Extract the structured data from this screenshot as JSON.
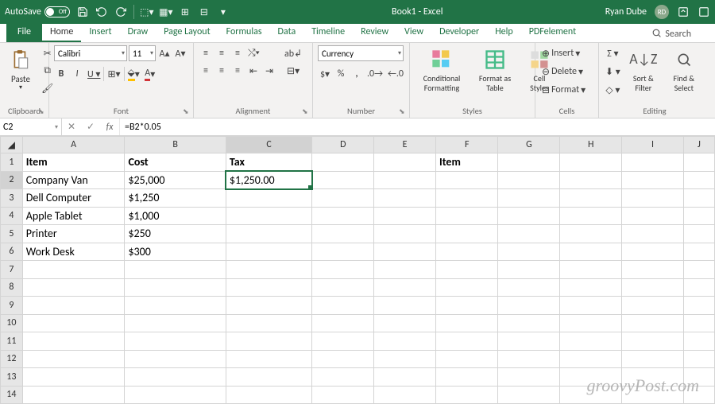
{
  "titlebar": {
    "autosave": "AutoSave",
    "toggle": "Off",
    "title": "Book1 - Excel",
    "user": "Ryan Dube",
    "initials": "RD"
  },
  "tabs": [
    "File",
    "Home",
    "Insert",
    "Draw",
    "Page Layout",
    "Formulas",
    "Data",
    "Timeline",
    "Review",
    "View",
    "Developer",
    "Help",
    "PDFelement"
  ],
  "search": "Search",
  "ribbon": {
    "clipboard": {
      "label": "Clipboard",
      "paste": "Paste"
    },
    "font": {
      "label": "Font",
      "name": "Calibri",
      "size": "11"
    },
    "alignment": {
      "label": "Alignment"
    },
    "number": {
      "label": "Number",
      "format": "Currency"
    },
    "styles": {
      "label": "Styles",
      "cond": "Conditional Formatting",
      "table": "Format as Table",
      "cell": "Cell Styles"
    },
    "cells": {
      "label": "Cells",
      "insert": "Insert",
      "delete": "Delete",
      "format": "Format"
    },
    "editing": {
      "label": "Editing",
      "sort": "Sort & Filter",
      "find": "Find & Select"
    }
  },
  "formulabar": {
    "cell": "C2",
    "formula": "=B2*0.05"
  },
  "sheet": {
    "cols": [
      "A",
      "B",
      "C",
      "D",
      "E",
      "F",
      "G",
      "H",
      "I",
      "J"
    ],
    "headerA": "Item",
    "headerB": "Cost",
    "headerC": "Tax",
    "headerF": "Item",
    "rows": [
      {
        "a": "Company Van",
        "b": "$25,000",
        "c": "$1,250.00"
      },
      {
        "a": "Dell Computer",
        "b": "$1,250"
      },
      {
        "a": "Apple Tablet",
        "b": "$1,000"
      },
      {
        "a": "Printer",
        "b": "$250"
      },
      {
        "a": "Work Desk",
        "b": "$300"
      }
    ]
  },
  "watermark": "groovyPost.com"
}
